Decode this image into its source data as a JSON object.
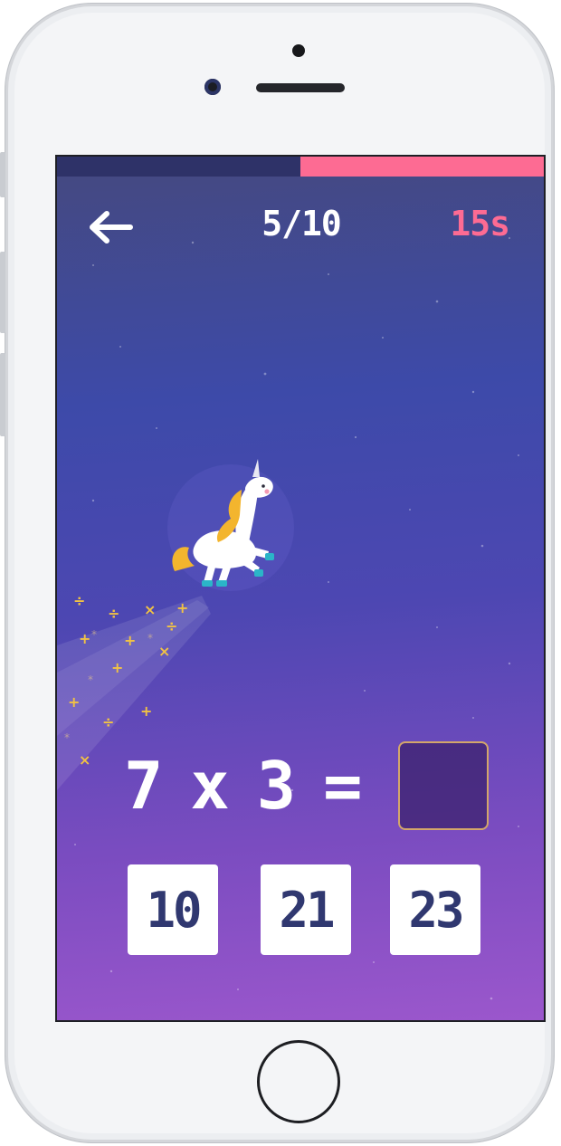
{
  "header": {
    "back_icon": "arrow-left-icon",
    "question_counter": "5/10",
    "timer": "15s"
  },
  "progress": {
    "fraction_remaining": 0.5,
    "track_color": "#2e3268",
    "fill_color": "#fd6b93"
  },
  "question": {
    "left_operand": "7",
    "operator": "x",
    "right_operand": "3",
    "equals": "=",
    "answer": ""
  },
  "choices": [
    {
      "label": "10"
    },
    {
      "label": "21"
    },
    {
      "label": "23"
    }
  ],
  "colors": {
    "accent_pink": "#fd6b93",
    "answer_box_border": "#d3a66a",
    "choice_text": "#303870"
  },
  "mascot": "unicorn-icon"
}
